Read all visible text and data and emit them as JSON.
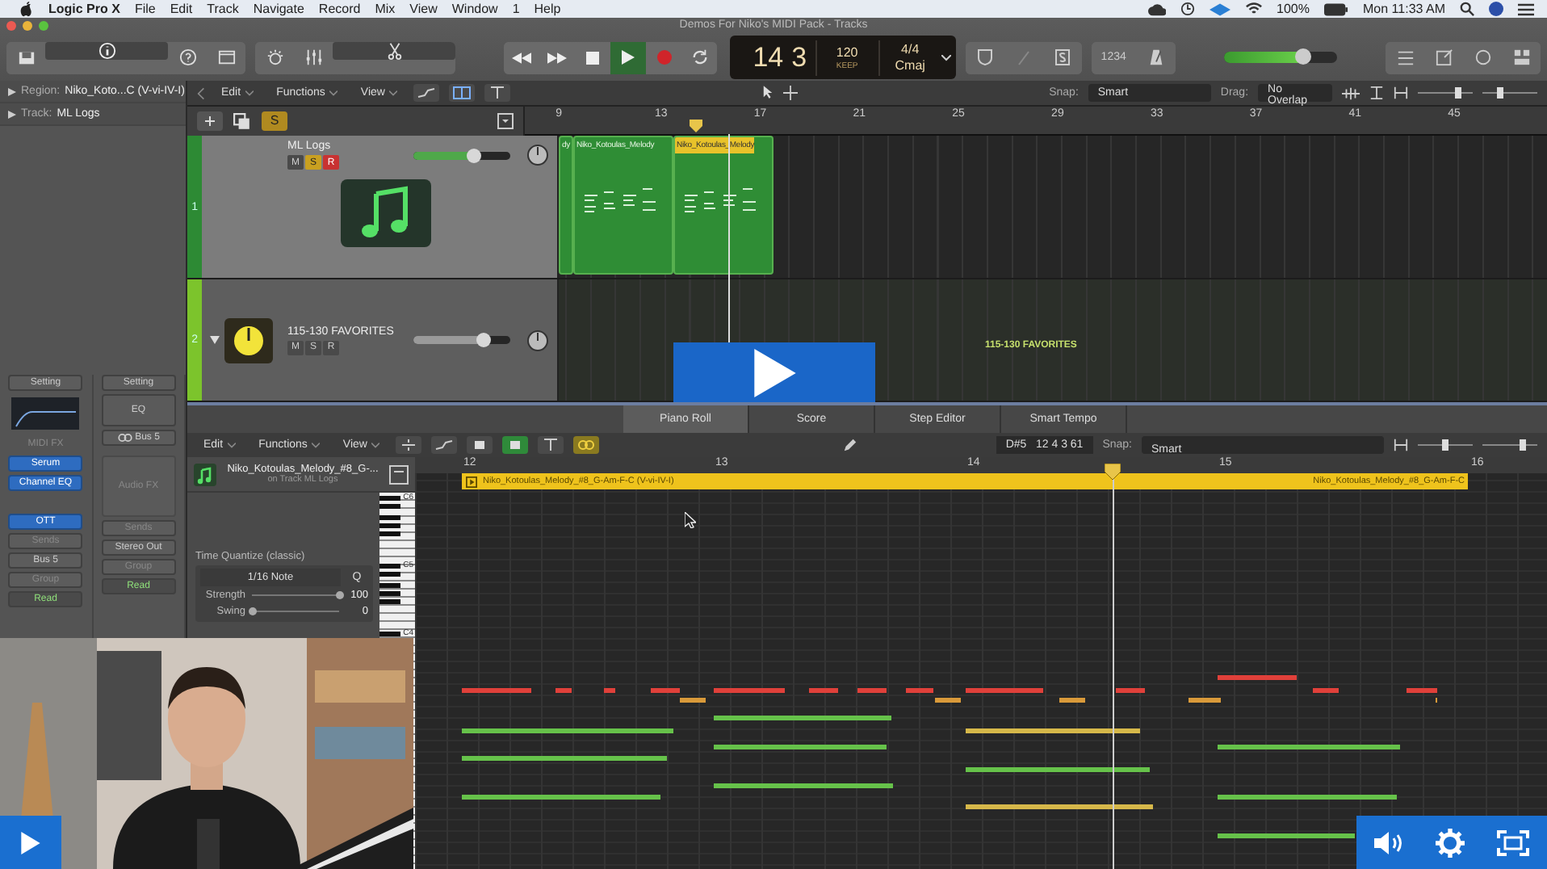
{
  "menubar": {
    "app": "Logic Pro X",
    "menus": [
      "File",
      "Edit",
      "Track",
      "Navigate",
      "Record",
      "Mix",
      "View",
      "Window",
      "1",
      "Help"
    ],
    "battery": "100%",
    "clock": "Mon 11:33 AM"
  },
  "window": {
    "title": "Demos For Niko's MIDI Pack - Tracks"
  },
  "transport": {
    "buttons": [
      {
        "kind": "rewind",
        "on": false
      },
      {
        "kind": "forward",
        "on": false
      },
      {
        "kind": "stop",
        "on": false
      },
      {
        "kind": "play",
        "on": true
      },
      {
        "kind": "record",
        "on": false
      },
      {
        "kind": "cycle",
        "on": false
      }
    ],
    "display": {
      "bar": "14",
      "beat": "3",
      "tempo": "120",
      "tempo_mode": "KEEP",
      "signature": "4/4",
      "key": "Cmaj"
    },
    "count_in": "1234",
    "master": {
      "level": 0.7
    }
  },
  "inspector": {
    "region_label": "Region:",
    "region": "Niko_Koto...C (V-vi-IV-I)",
    "track_label": "Track:",
    "track": "ML Logs",
    "strips": [
      {
        "setting": "Setting",
        "fx_label": "MIDI FX",
        "plugins": [
          "Serum",
          "Channel EQ",
          "OTT"
        ],
        "sends": "Sends",
        "output": "Bus 5",
        "group": "Group",
        "automation": "Read"
      },
      {
        "setting": "Setting",
        "eq": "EQ",
        "input": "Bus 5",
        "fx_label": "Audio FX",
        "sends": "Sends",
        "output": "Stereo Out",
        "group": "Group",
        "automation": "Read"
      }
    ]
  },
  "tracks_area": {
    "menus": [
      "Edit",
      "Functions",
      "View"
    ],
    "snap_label": "Snap:",
    "snap": "Smart",
    "drag_label": "Drag:",
    "drag": "No Overlap",
    "header_solo": "S",
    "zoom_sliders": [
      {
        "level": 0.75
      },
      {
        "level": 0.3
      }
    ],
    "ruler": [
      "9",
      "13",
      "17",
      "21",
      "25",
      "29",
      "33",
      "37",
      "41",
      "45"
    ],
    "tracks": [
      {
        "number": "1",
        "name": "ML Logs",
        "kind": "midi",
        "selected": true,
        "mute_label": "M",
        "mute": false,
        "solo_label": "S",
        "solo": true,
        "record_label": "R",
        "record": true,
        "volume": {
          "level": 0.62
        },
        "regions": [
          {
            "name": "dy",
            "selected": false
          },
          {
            "name": "Niko_Kotoulas_Melody",
            "selected": false
          },
          {
            "name": "Niko_Kotoulas_Melody",
            "selected": true
          }
        ]
      },
      {
        "number": "2",
        "name": "115-130 FAVORITES",
        "kind": "instrument",
        "selected": false,
        "mute_label": "M",
        "mute": false,
        "solo_label": "S",
        "solo": false,
        "record_label": "R",
        "record": false,
        "volume": {
          "level": 0.72
        },
        "lane_label": "115-130 FAVORITES"
      }
    ]
  },
  "editor": {
    "tabs": [
      {
        "label": "Piano Roll",
        "selected": true
      },
      {
        "label": "Score",
        "selected": false
      },
      {
        "label": "Step Editor",
        "selected": false
      },
      {
        "label": "Smart Tempo",
        "selected": false
      }
    ],
    "menus": [
      "Edit",
      "Functions",
      "View"
    ],
    "position": "D#5   12 4 3 61",
    "snap_label": "Snap:",
    "snap": "Smart",
    "zoom_sliders": [
      {
        "level": 0.5
      },
      {
        "level": 0.75
      }
    ],
    "region": {
      "name": "Niko_Kotoulas_Melody_#8_G-...",
      "track": "on Track ML Logs"
    },
    "quantize": {
      "title": "Time Quantize (classic)",
      "value": "1/16 Note",
      "q": "Q",
      "params": [
        {
          "label": "Strength",
          "value": "100",
          "level": 1
        },
        {
          "label": "Swing",
          "value": "0",
          "level": 0
        }
      ]
    },
    "keys": [
      "C6",
      "C5",
      "C4"
    ],
    "ruler": [
      "12",
      "13",
      "14",
      "15",
      "16"
    ],
    "region_bar": "Niko_Kotoulas_Melody_#8_G-Am-F-C (V-vi-IV-I)",
    "region_bar_end": "Niko_Kotoulas_Melody_#8_G-Am-F-C"
  }
}
